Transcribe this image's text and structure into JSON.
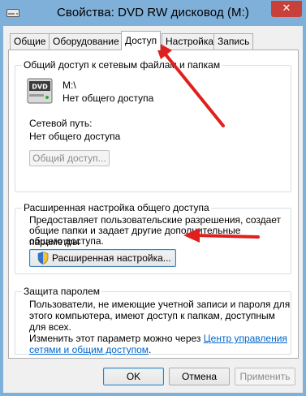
{
  "window": {
    "title": "Свойства: DVD RW дисковод (M:)",
    "close_glyph": "✕"
  },
  "tabs": [
    {
      "label": "Общие"
    },
    {
      "label": "Оборудование"
    },
    {
      "label": "Доступ",
      "active": true
    },
    {
      "label": "Настройка"
    },
    {
      "label": "Запись"
    }
  ],
  "sharing": {
    "group_title": "Общий доступ к сетевым файлам и папкам",
    "drive_icon_text": "DVD",
    "drive_name": "M:\\",
    "drive_status": "Нет общего доступа",
    "network_path_label": "Сетевой путь:",
    "network_path_value": "Нет общего доступа",
    "share_button": "Общий доступ..."
  },
  "advanced": {
    "group_title": "Расширенная настройка общего доступа",
    "description_lines": [
      "Предоставляет пользовательские разрешения, создает",
      "общие папки и задает другие дополнительные параметры",
      "общего доступа."
    ],
    "button": "Расширенная настройка..."
  },
  "password": {
    "group_title": "Защита паролем",
    "description_lines": [
      "Пользователи, не имеющие учетной записи и пароля для",
      "этого компьютера, имеют доступ к папкам, доступным",
      "для всех."
    ],
    "change_text": "Изменить этот параметр можно через",
    "link_line1": "Центр управления",
    "link_line2": "сетями и общим доступом",
    "link_suffix": "."
  },
  "footer": {
    "ok": "OK",
    "cancel": "Отмена",
    "apply": "Применить"
  },
  "colors": {
    "arrow": "#e0201c",
    "link": "#0066cc",
    "titlebar": "#7fb0d9",
    "close": "#c7403a"
  }
}
